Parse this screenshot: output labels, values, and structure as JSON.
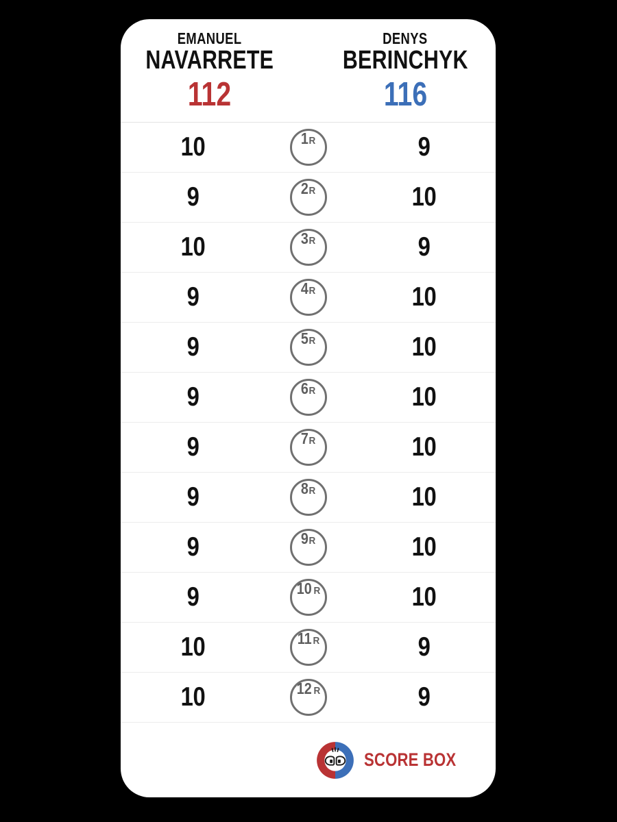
{
  "background_color": "#000000",
  "card_color": "#ffffff",
  "colors": {
    "red": "#b93334",
    "blue": "#3c6fb8",
    "round_circle": "#707070",
    "round_text": "#5e5e5e",
    "score_text": "#111111",
    "row_divider": "#ececec"
  },
  "header": {
    "fighter_left": {
      "first_name": "EMANUEL",
      "last_name": "NAVARRETE",
      "total": "112",
      "color": "#b93334"
    },
    "fighter_right": {
      "first_name": "DENYS",
      "last_name": "BERINCHYK",
      "total": "116",
      "color": "#3c6fb8"
    }
  },
  "round_suffix": "R",
  "rounds": [
    {
      "round": "1",
      "left": "10",
      "right": "9"
    },
    {
      "round": "2",
      "left": "9",
      "right": "10"
    },
    {
      "round": "3",
      "left": "10",
      "right": "9"
    },
    {
      "round": "4",
      "left": "9",
      "right": "10"
    },
    {
      "round": "5",
      "left": "9",
      "right": "10"
    },
    {
      "round": "6",
      "left": "9",
      "right": "10"
    },
    {
      "round": "7",
      "left": "9",
      "right": "10"
    },
    {
      "round": "8",
      "left": "9",
      "right": "10"
    },
    {
      "round": "9",
      "left": "9",
      "right": "10"
    },
    {
      "round": "10",
      "left": "9",
      "right": "10"
    },
    {
      "round": "11",
      "left": "10",
      "right": "9"
    },
    {
      "round": "12",
      "left": "10",
      "right": "9"
    }
  ],
  "footer": {
    "brand_name": "SCORE BOX",
    "logo_icon": "boxing-gloves-icon",
    "logo_left_color": "#b93334",
    "logo_right_color": "#3c6fb8"
  }
}
